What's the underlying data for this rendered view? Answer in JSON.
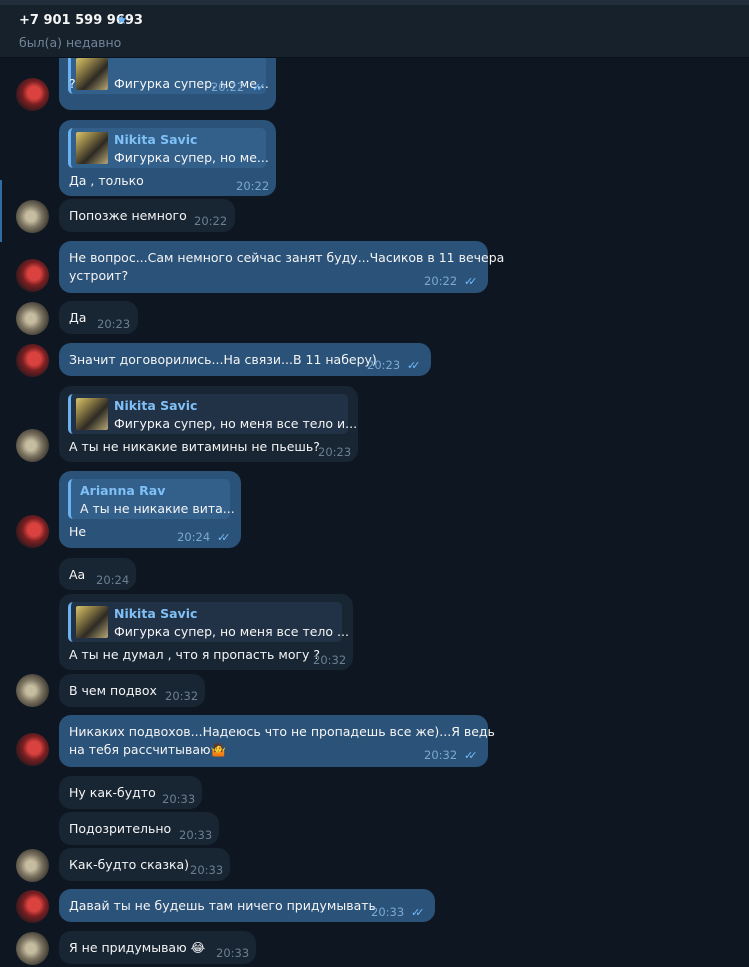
{
  "header": {
    "contact": "+7 901 599 9693",
    "status": "был(а) недавно",
    "star_icon": "★"
  },
  "messages": [
    {
      "text": "?",
      "time": "20:22",
      "reply_text": "Фигурка супер, но ме..."
    },
    {
      "text": "Да , только",
      "time": "20:22",
      "reply_name": "Nikita Savic",
      "reply_text": "Фигурка супер, но ме..."
    },
    {
      "text": "Попозже немного",
      "time": "20:22"
    },
    {
      "text": "Не вопрос...Сам немного сейчас занят буду...Часиков в 11 вечера",
      "text2": "устроит?",
      "time": "20:22"
    },
    {
      "text": "Да",
      "time": "20:23"
    },
    {
      "text": "Значит договорились...На связи...В 11 наберу)",
      "time": "20:23"
    },
    {
      "text": "А ты не никакие витамины не пьешь?",
      "time": "20:23",
      "reply_name": "Nikita Savic",
      "reply_text": "Фигурка супер, но меня все тело и..."
    },
    {
      "text": "Не",
      "time": "20:24",
      "reply_name": "Arianna Rav",
      "reply_text": "А ты не никакие вита..."
    },
    {
      "text": "Аа",
      "time": "20:24"
    },
    {
      "text": "А ты не думал , что я пропасть могу ?",
      "time": "20:32",
      "reply_name": "Nikita Savic",
      "reply_text": "Фигурка супер, но меня все тело ..."
    },
    {
      "text": "В чем подвох",
      "time": "20:32"
    },
    {
      "text": "Никаких подвохов...Надеюсь что не пропадешь все же)...Я ведь",
      "text2": "на тебя рассчитываю🤷",
      "time": "20:32"
    },
    {
      "text": "Ну как-будто",
      "time": "20:33"
    },
    {
      "text": "Подозрительно",
      "time": "20:33"
    },
    {
      "text": "Как-будто сказка)",
      "time": "20:33"
    },
    {
      "text": "Давай ты не будешь там ничего придумывать",
      "time": "20:33"
    },
    {
      "text": "Я не придумываю 😂",
      "time": "20:33"
    }
  ],
  "read_checks": "✓✓"
}
